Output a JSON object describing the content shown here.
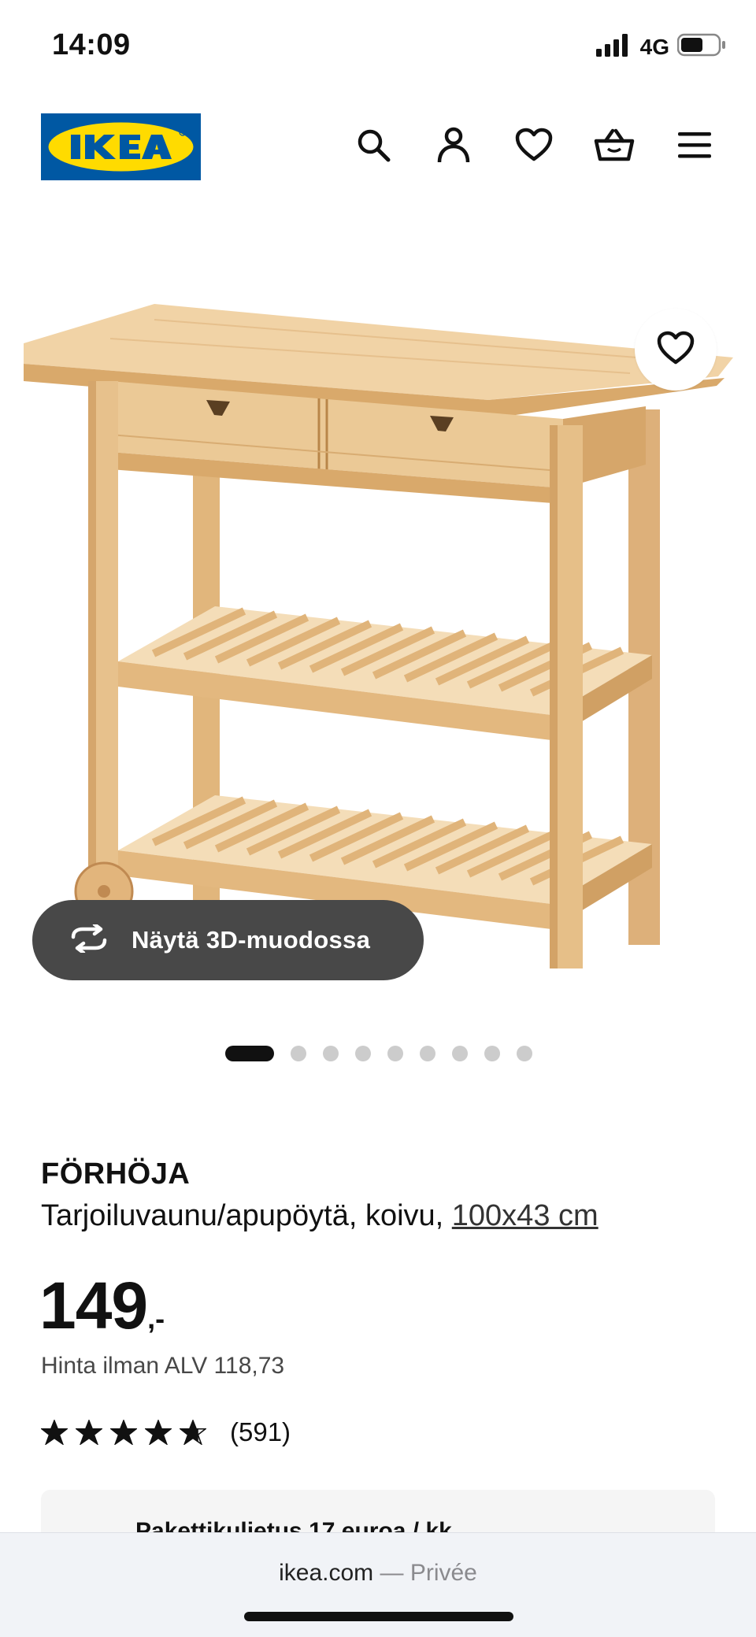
{
  "status_bar": {
    "time": "14:09",
    "network": "4G",
    "icons": [
      "signal-icon",
      "battery-icon"
    ]
  },
  "header": {
    "logo_text": "IKEA",
    "icons": [
      "search-icon",
      "account-icon",
      "heart-icon",
      "basket-icon",
      "menu-icon"
    ]
  },
  "gallery": {
    "view_3d_label": "Näytä 3D-muodossa",
    "image_count": 9,
    "active_index": 0,
    "favorite_icon": "heart-icon"
  },
  "product": {
    "name": "FÖRHÖJA",
    "description": "Tarjoiluvaunu/apupöytä, koivu, ",
    "size": "100x43 cm",
    "price": "149",
    "price_suffix": ",-",
    "price_excl_vat": "Hinta ilman ALV 118,73",
    "rating": 4.7,
    "review_count": "(591)"
  },
  "delivery": {
    "text": "Pakettikuljetus 17 euroa / kk..."
  },
  "browser": {
    "url": "ikea.com",
    "separator": " — ",
    "mode": "Privée"
  },
  "colors": {
    "ikea_blue": "#0058A3",
    "ikea_yellow": "#FFDB00",
    "button_dark": "#484848",
    "wood_light": "#EFCF9E",
    "wood_mid": "#E1B67C",
    "wood_dark": "#C7955A"
  }
}
